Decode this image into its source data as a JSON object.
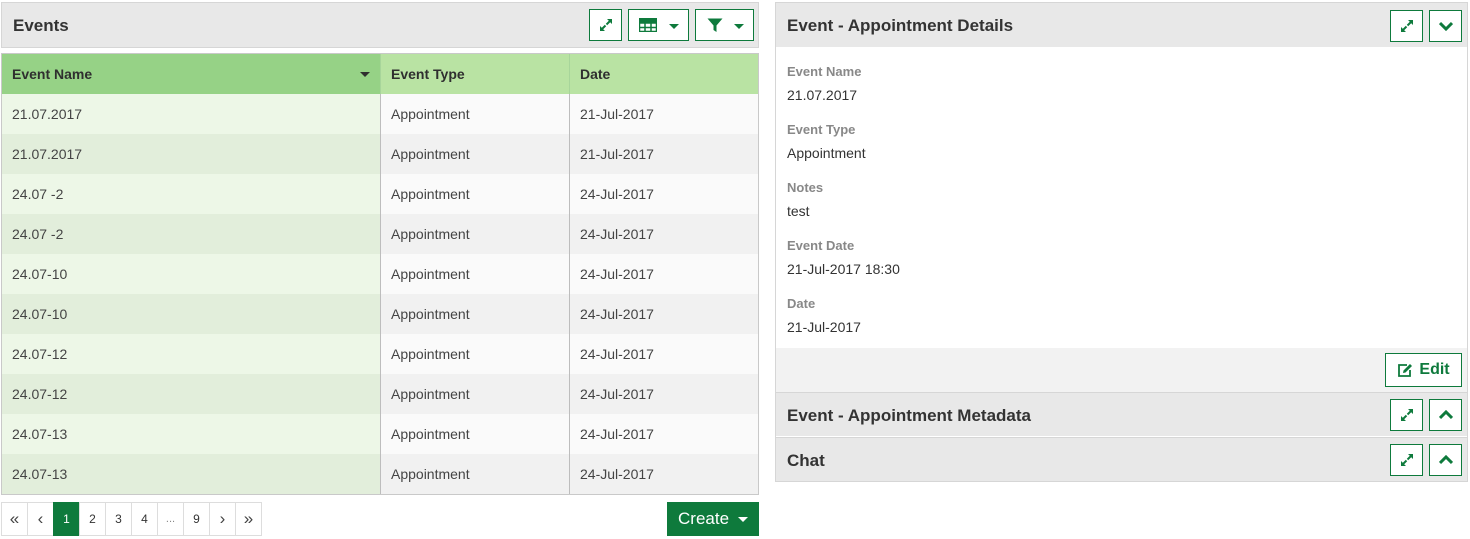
{
  "events_panel": {
    "title": "Events",
    "icons": {
      "expand": "expand-arrows-icon",
      "table": "table-grid-icon",
      "filter": "filter-funnel-icon"
    }
  },
  "grid": {
    "columns": [
      "Event Name",
      "Event Type",
      "Date"
    ],
    "sorted_column": "Event Name",
    "rows": [
      [
        "21.07.2017",
        "Appointment",
        "21-Jul-2017"
      ],
      [
        "21.07.2017",
        "Appointment",
        "21-Jul-2017"
      ],
      [
        "24.07 -2",
        "Appointment",
        "24-Jul-2017"
      ],
      [
        "24.07 -2",
        "Appointment",
        "24-Jul-2017"
      ],
      [
        "24.07-10",
        "Appointment",
        "24-Jul-2017"
      ],
      [
        "24.07-10",
        "Appointment",
        "24-Jul-2017"
      ],
      [
        "24.07-12",
        "Appointment",
        "24-Jul-2017"
      ],
      [
        "24.07-12",
        "Appointment",
        "24-Jul-2017"
      ],
      [
        "24.07-13",
        "Appointment",
        "24-Jul-2017"
      ],
      [
        "24.07-13",
        "Appointment",
        "24-Jul-2017"
      ]
    ]
  },
  "pager": {
    "first": "«",
    "prev": "‹",
    "pages": [
      "1",
      "2",
      "3",
      "4",
      "...",
      "9"
    ],
    "current": "1",
    "next": "›",
    "last": "»"
  },
  "create_label": "Create",
  "details_panel": {
    "title": "Event - Appointment Details",
    "fields": [
      {
        "label": "Event Name",
        "value": "21.07.2017"
      },
      {
        "label": "Event Type",
        "value": "Appointment"
      },
      {
        "label": "Notes",
        "value": "test"
      },
      {
        "label": "Event Date",
        "value": "21-Jul-2017 18:30"
      },
      {
        "label": "Date",
        "value": "21-Jul-2017"
      }
    ],
    "edit_label": "Edit"
  },
  "metadata_panel": {
    "title": "Event - Appointment Metadata"
  },
  "chat_panel": {
    "title": "Chat"
  },
  "colors": {
    "accent": "#0e7a3c",
    "header_green": "#b9e3a3",
    "sorted_header_green": "#96d286",
    "panel_header": "#e8e8e8"
  }
}
